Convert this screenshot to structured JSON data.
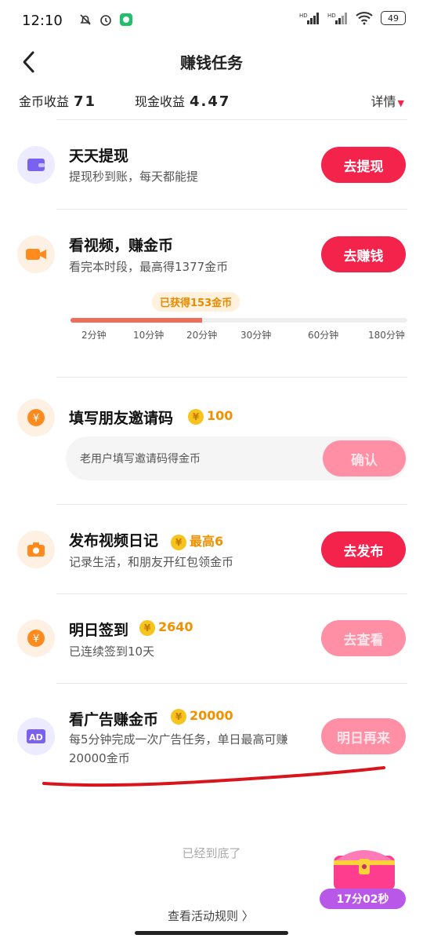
{
  "status": {
    "time": "12:10",
    "battery": "49",
    "hd1": "HD",
    "hd2": "HD"
  },
  "nav": {
    "title": "赚钱任务"
  },
  "earnings": {
    "coin_label": "金币收益",
    "coin_value": "71",
    "cash_label": "现金收益",
    "cash_value": "4.47",
    "detail": "详情"
  },
  "tasks": {
    "withdraw": {
      "name": "天天提现",
      "desc": "提现秒到账，每天都能提",
      "button": "去提现"
    },
    "video": {
      "name": "看视频，赚金币",
      "desc": "看完本时段，最高得1377金币",
      "button": "去赚钱",
      "got": "已获得153金币",
      "progress_fraction": 0.39,
      "ticks": [
        "2分钟",
        "10分钟",
        "20分钟",
        "30分钟",
        "60分钟",
        "180分钟"
      ]
    },
    "invite": {
      "name": "填写朋友邀请码",
      "reward": "100",
      "placeholder": "老用户填写邀请码得金币",
      "button": "确认"
    },
    "diary": {
      "name": "发布视频日记",
      "reward": "最高6",
      "desc": "记录生活，和朋友开红包领金币",
      "button": "去发布"
    },
    "signin": {
      "name": "明日签到",
      "reward": "2640",
      "desc": "已连续签到10天",
      "button": "去查看"
    },
    "ads": {
      "name": "看广告赚金币",
      "reward": "20000",
      "desc": "每5分钟完成一次广告任务，单日最高可赚20000金币",
      "button": "明日再来",
      "icon_text": "AD"
    }
  },
  "footer": {
    "end_note": "已经到底了",
    "rules": "查看活动规则 〉",
    "timer": "17分02秒"
  },
  "colors": {
    "accent": "#f3234c",
    "accent_dim": "#ff8fa5",
    "coin": "#f7c31d",
    "reward_text": "#f29100"
  }
}
